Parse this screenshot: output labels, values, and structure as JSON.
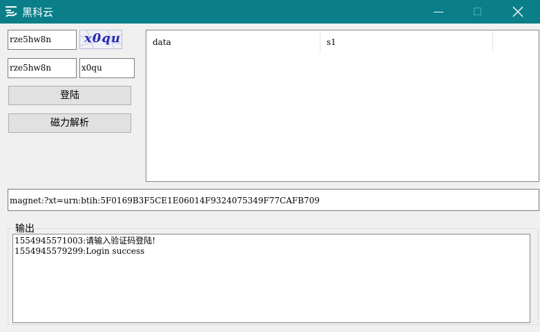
{
  "window": {
    "title": "黑科云"
  },
  "login": {
    "username_value": "rze5hw8n",
    "captcha_image_text": "x0qu",
    "password_value": "rze5hw8n",
    "captcha_input_value": "x0qu",
    "login_button": "登陆",
    "parse_button": "磁力解析"
  },
  "list": {
    "columns": [
      "data",
      "s1"
    ]
  },
  "magnet": {
    "value": "magnet:?xt=urn:btih:5F0169B3F5CE1E06014F9324075349F77CAFB709"
  },
  "output": {
    "label": "输出",
    "lines": [
      "1554945571003:请输入验证码登陆!",
      "1554945579299:Login success"
    ]
  },
  "colors": {
    "titlebar": "#0a7f8a",
    "captcha_text": "#2a2ab0"
  }
}
